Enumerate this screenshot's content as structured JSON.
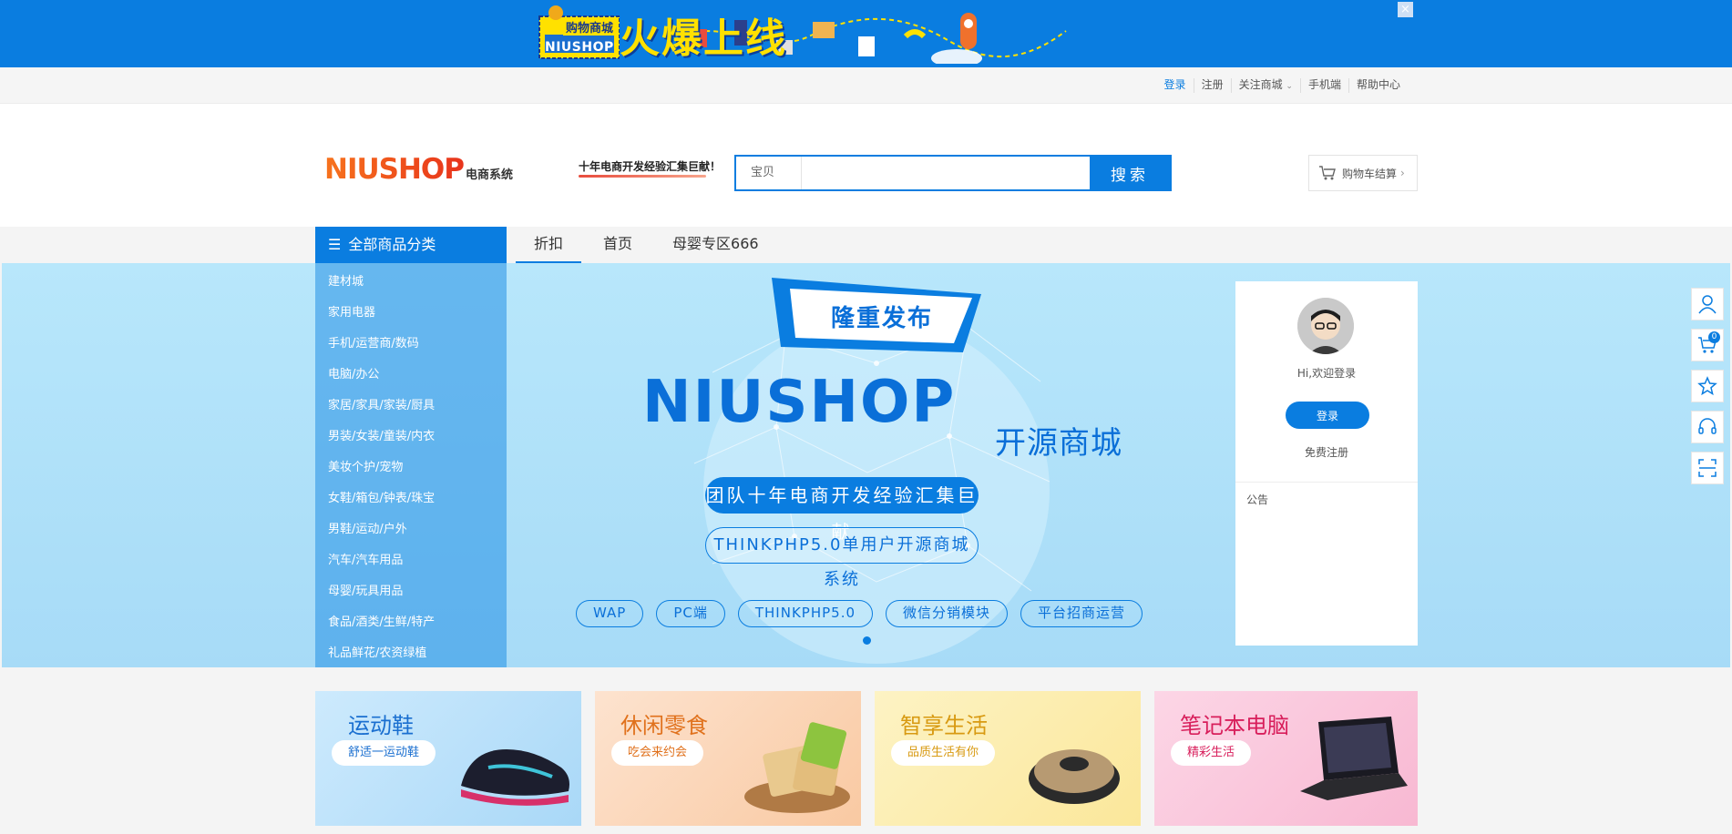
{
  "top_banner": {
    "small_label": "购物商城",
    "brand": "NIUSHOP",
    "headline": "火爆上线",
    "close_label": "×"
  },
  "site_nav": {
    "items": [
      "登录",
      "注册",
      "关注商城",
      "手机端",
      "帮助中心"
    ]
  },
  "header": {
    "logo_text": "NIUSHOP",
    "logo_sub": "电商系统",
    "slogan": "十年电商开发经验汇集巨献！",
    "search": {
      "type_label": "宝贝",
      "placeholder": "",
      "button": "搜索"
    },
    "cart_label": "购物车结算"
  },
  "category_header": "全部商品分类",
  "categories": [
    "建材城",
    "家用电器",
    "手机/运营商/数码",
    "电脑/办公",
    "家居/家具/家装/厨具",
    "男装/女装/童装/内衣",
    "美妆个护/宠物",
    "女鞋/箱包/钟表/珠宝",
    "男鞋/运动/户外",
    "汽车/汽车用品",
    "母婴/玩具用品",
    "食品/酒类/生鲜/特产",
    "礼品鲜花/农资绿植"
  ],
  "tabs": [
    "折扣",
    "首页",
    "母婴专区666"
  ],
  "hero": {
    "tag": "隆重发布",
    "title": "NIUSHOP",
    "subtitle": "开源商城",
    "pill_solid": "团队十年电商开发经验汇集巨献",
    "pill_outline": "THINKPHP5.0单用户开源商城系统",
    "chips": [
      "WAP",
      "PC端",
      "THINKPHP5.0",
      "微信分销模块",
      "平台招商运营"
    ]
  },
  "login_panel": {
    "welcome": "Hi,欢迎登录",
    "login_button": "登录",
    "register_link": "免费注册",
    "notice_title": "公告"
  },
  "right_toolbar": {
    "cart_count": "0"
  },
  "promos": [
    {
      "title": "运动鞋",
      "tag": "舒适一运动鞋",
      "title_color": "#1a6fd0",
      "tag_color": "#1a6fd0"
    },
    {
      "title": "休闲零食",
      "tag": "吃会来约会",
      "title_color": "#e0711c",
      "tag_color": "#e0711c"
    },
    {
      "title": "智享生活",
      "tag": "品质生活有你",
      "title_color": "#d89a12",
      "tag_color": "#d89a12"
    },
    {
      "title": "笔记本电脑",
      "tag": "精彩生活",
      "title_color": "#d81e5b",
      "tag_color": "#d81e5b"
    }
  ],
  "colors": {
    "primary": "#0a7de0",
    "banner_bg": "#0a7de0",
    "hero_bg": "#b8e7fb"
  }
}
